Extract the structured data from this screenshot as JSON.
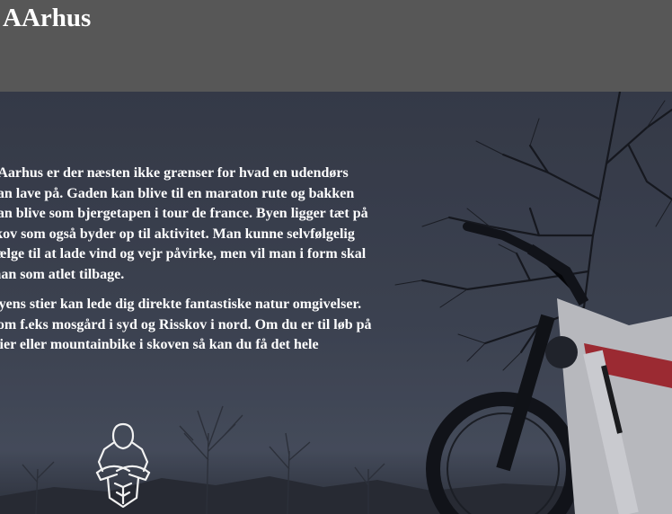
{
  "header": {
    "title": "AArhus"
  },
  "intro": {
    "paragraphs": [
      [
        "I Aarhus er der næsten ikke grænser for hvad en udendørs",
        "kan lave på. Gaden kan blive til en maraton rute og bakken",
        "kan blive som bjergetapen i tour de france. Byen ligger tæt på",
        "skov som også byder op til aktivitet. Man kunne selvfølgelig",
        "vælge til at lade vind og vejr påvirke, men vil man i form skal",
        "man som atlet tilbage."
      ],
      [
        "Byens stier kan lede dig direkte fantastiske natur omgivelser.",
        "Som f.eks mosgård i syd og Risskov i nord. Om du er til løb på",
        "stier eller mountainbike i skoven så kan du få det hele"
      ]
    ]
  },
  "logo": {
    "icon": "athlete-crossed-arms-icon"
  },
  "colors": {
    "header_bg": "#575757",
    "text": "#ffffff",
    "sky": "#3d4350"
  }
}
